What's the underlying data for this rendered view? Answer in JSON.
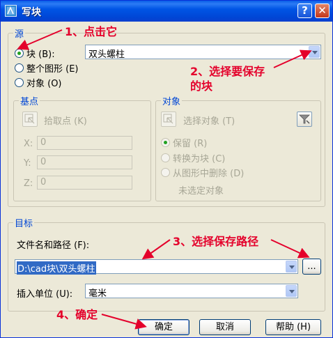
{
  "window": {
    "title": "写块",
    "help_symbol": "?",
    "close_symbol": "✕"
  },
  "source": {
    "label": "源",
    "radio_block": "块 (B):",
    "radio_entire": "整个图形 (E)",
    "radio_objects": "对象 (O)",
    "selected": "block",
    "block_name": "双头螺柱"
  },
  "base_point": {
    "label": "基点",
    "pick_point": "拾取点 (K)",
    "x_label": "X:",
    "y_label": "Y:",
    "z_label": "Z:",
    "x_value": "0",
    "y_value": "0",
    "z_value": "0"
  },
  "objects": {
    "label": "对象",
    "select_objects": "选择对象 (T)",
    "retain": "保留 (R)",
    "convert": "转换为块 (C)",
    "delete": "从图形中删除 (D)",
    "selected": "retain",
    "status": "未选定对象"
  },
  "target": {
    "label": "目标",
    "file_label": "文件名和路径 (F):",
    "file_value": "D:\\cad块\\双头螺柱",
    "browse_label": "...",
    "unit_label": "插入单位 (U):",
    "unit_value": "毫米"
  },
  "buttons": {
    "ok": "确定",
    "cancel": "取消",
    "help": "帮助 (H)"
  },
  "annotations": {
    "step1": "1、点击它",
    "step2_line1": "2、选择要保存",
    "step2_line2": "的块",
    "step3": "3、选择保存路径",
    "step4": "4、确定",
    "color": "#e4002b"
  }
}
